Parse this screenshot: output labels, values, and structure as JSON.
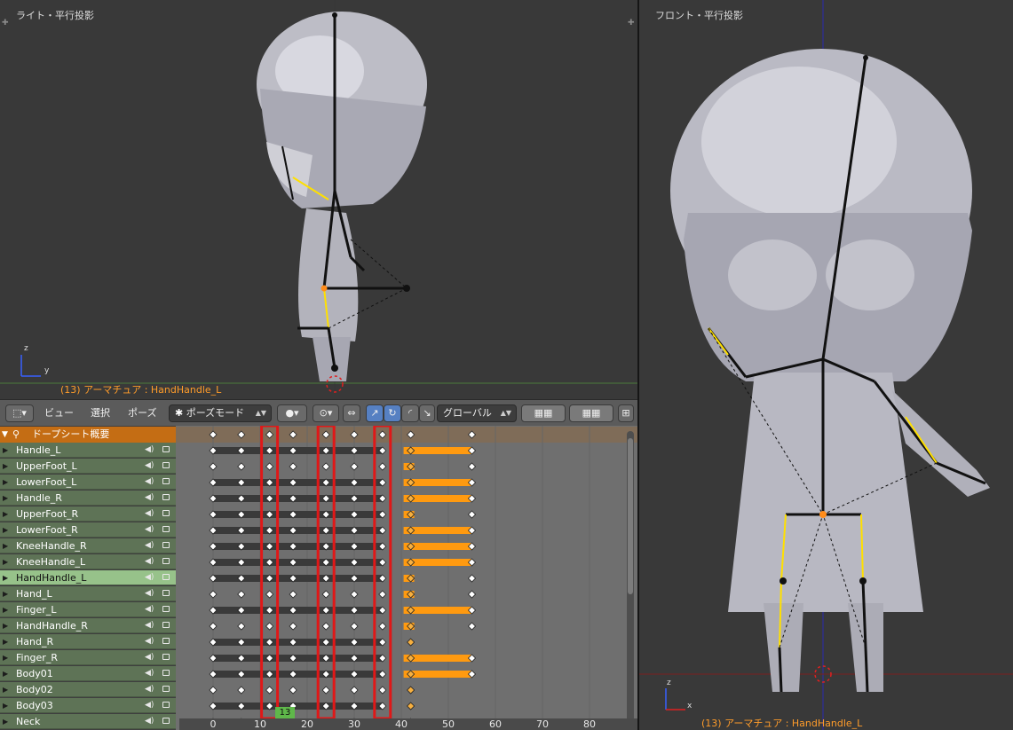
{
  "viewports": {
    "side": {
      "title": "ライト・平行投影",
      "status": "(13) アーマチュア : HandHandle_L",
      "axis_z": "z",
      "axis_y": "y"
    },
    "front": {
      "title": "フロント・平行投影",
      "status": "(13) アーマチュア : HandHandle_L",
      "axis_z": "z",
      "axis_x": "x"
    }
  },
  "dopesheet_header": {
    "menus": [
      "ビュー",
      "選択",
      "ポーズ"
    ],
    "mode": "ポーズモード",
    "orientation": "グローバル"
  },
  "dopesheet": {
    "summary": "ドープシート概要",
    "channels": [
      {
        "name": "Handle_L",
        "selected": false
      },
      {
        "name": "UpperFoot_L",
        "selected": false
      },
      {
        "name": "LowerFoot_L",
        "selected": false
      },
      {
        "name": "Handle_R",
        "selected": false
      },
      {
        "name": "UpperFoot_R",
        "selected": false
      },
      {
        "name": "LowerFoot_R",
        "selected": false
      },
      {
        "name": "KneeHandle_R",
        "selected": false
      },
      {
        "name": "KneeHandle_L",
        "selected": false
      },
      {
        "name": "HandHandle_L",
        "selected": true
      },
      {
        "name": "Hand_L",
        "selected": false
      },
      {
        "name": "Finger_L",
        "selected": false
      },
      {
        "name": "HandHandle_R",
        "selected": false
      },
      {
        "name": "Hand_R",
        "selected": false
      },
      {
        "name": "Finger_R",
        "selected": false
      },
      {
        "name": "Body01",
        "selected": false
      },
      {
        "name": "Body02",
        "selected": false
      },
      {
        "name": "Body03",
        "selected": false
      },
      {
        "name": "Neck",
        "selected": false
      }
    ],
    "current_frame": "13",
    "ruler_ticks": [
      "0",
      "10",
      "20",
      "30",
      "40",
      "50",
      "60",
      "70",
      "80"
    ],
    "keyframes_common": [
      0,
      6,
      12,
      17,
      24,
      30,
      36
    ],
    "keyframes_selected": [
      42,
      55
    ],
    "highlight_frames": [
      12,
      24,
      36
    ]
  },
  "colors": {
    "summary_orange": "#c46d14",
    "channel_green": "#5e7356",
    "selected_channel": "#97c28a",
    "highlight_box": "#e01818",
    "hold_bar": "#ff9a10",
    "bone_active": "#ffe000"
  }
}
